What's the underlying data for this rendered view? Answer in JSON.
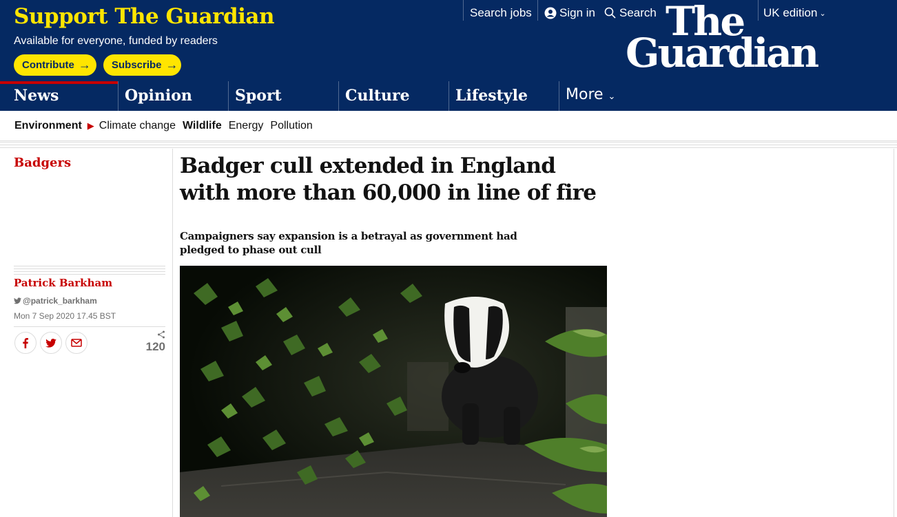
{
  "header": {
    "support_title": "Support The Guardian",
    "support_subtitle": "Available for everyone, funded by readers",
    "contribute_label": "Contribute",
    "subscribe_label": "Subscribe",
    "search_jobs": "Search jobs",
    "sign_in": "Sign in",
    "search": "Search",
    "edition": "UK edition",
    "logo_line1": "The",
    "logo_line2": "Guardian"
  },
  "pillars": [
    {
      "label": "News",
      "active": true
    },
    {
      "label": "Opinion",
      "active": false
    },
    {
      "label": "Sport",
      "active": false
    },
    {
      "label": "Culture",
      "active": false
    },
    {
      "label": "Lifestyle",
      "active": false
    }
  ],
  "more_label": "More",
  "subnav": {
    "section": "Environment",
    "items": [
      "Climate change",
      "Wildlife",
      "Energy",
      "Pollution"
    ]
  },
  "article": {
    "kicker": "Badgers",
    "headline": "Badger cull extended in England with more than 60,000 in line of fire",
    "standfirst": "Campaigners say expansion is a betrayal as government had pledged to phase out cull",
    "author": "Patrick Barkham",
    "twitter": "@patrick_barkham",
    "date": "Mon 7 Sep 2020 17.45 BST",
    "share_count": "120"
  },
  "colors": {
    "brand_blue": "#052962",
    "brand_yellow": "#ffe500",
    "news_red": "#c70000"
  },
  "icons": [
    "arrow-right-icon",
    "user-icon",
    "search-icon",
    "chevron-down-icon",
    "facebook-icon",
    "twitter-icon",
    "email-icon",
    "share-icon"
  ]
}
